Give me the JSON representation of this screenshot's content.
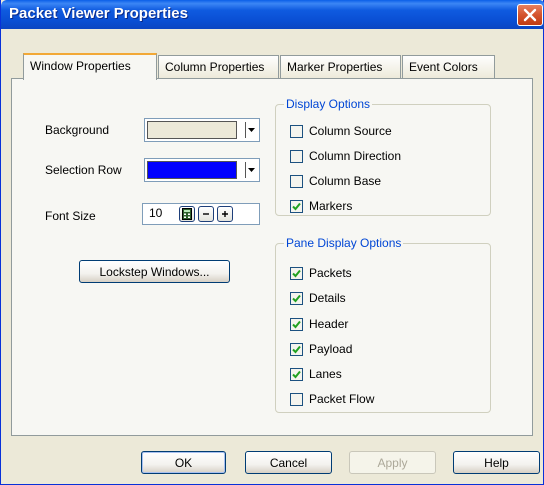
{
  "window": {
    "title": "Packet Viewer Properties"
  },
  "tabs": [
    {
      "label": "Window Properties",
      "active": true
    },
    {
      "label": "Column Properties",
      "active": false
    },
    {
      "label": "Marker Properties",
      "active": false
    },
    {
      "label": "Event Colors",
      "active": false
    }
  ],
  "window_props": {
    "background_label": "Background",
    "background_color": "#ece9d8",
    "selection_label": "Selection Row",
    "selection_color": "#0000ff",
    "font_size_label": "Font Size",
    "font_size_value": "10",
    "lockstep_label": "Lockstep Windows..."
  },
  "display_options": {
    "title": "Display Options",
    "items": [
      {
        "label": "Column Source",
        "checked": false
      },
      {
        "label": "Column Direction",
        "checked": false
      },
      {
        "label": "Column Base",
        "checked": false
      },
      {
        "label": "Markers",
        "checked": true
      }
    ]
  },
  "pane_display_options": {
    "title": "Pane Display Options",
    "items": [
      {
        "label": "Packets",
        "checked": true
      },
      {
        "label": "Details",
        "checked": true
      },
      {
        "label": "Header",
        "checked": true
      },
      {
        "label": "Payload",
        "checked": true
      },
      {
        "label": "Lanes",
        "checked": true
      },
      {
        "label": "Packet Flow",
        "checked": false
      }
    ]
  },
  "footer": {
    "ok_label": "OK",
    "cancel_label": "Cancel",
    "apply_label": "Apply",
    "help_label": "Help"
  },
  "icons": {
    "close": "close-icon",
    "dropdown": "dropdown-arrow-icon",
    "calculator": "calculator-icon",
    "minus": "minus-icon",
    "plus": "plus-icon",
    "check": "check-icon"
  }
}
